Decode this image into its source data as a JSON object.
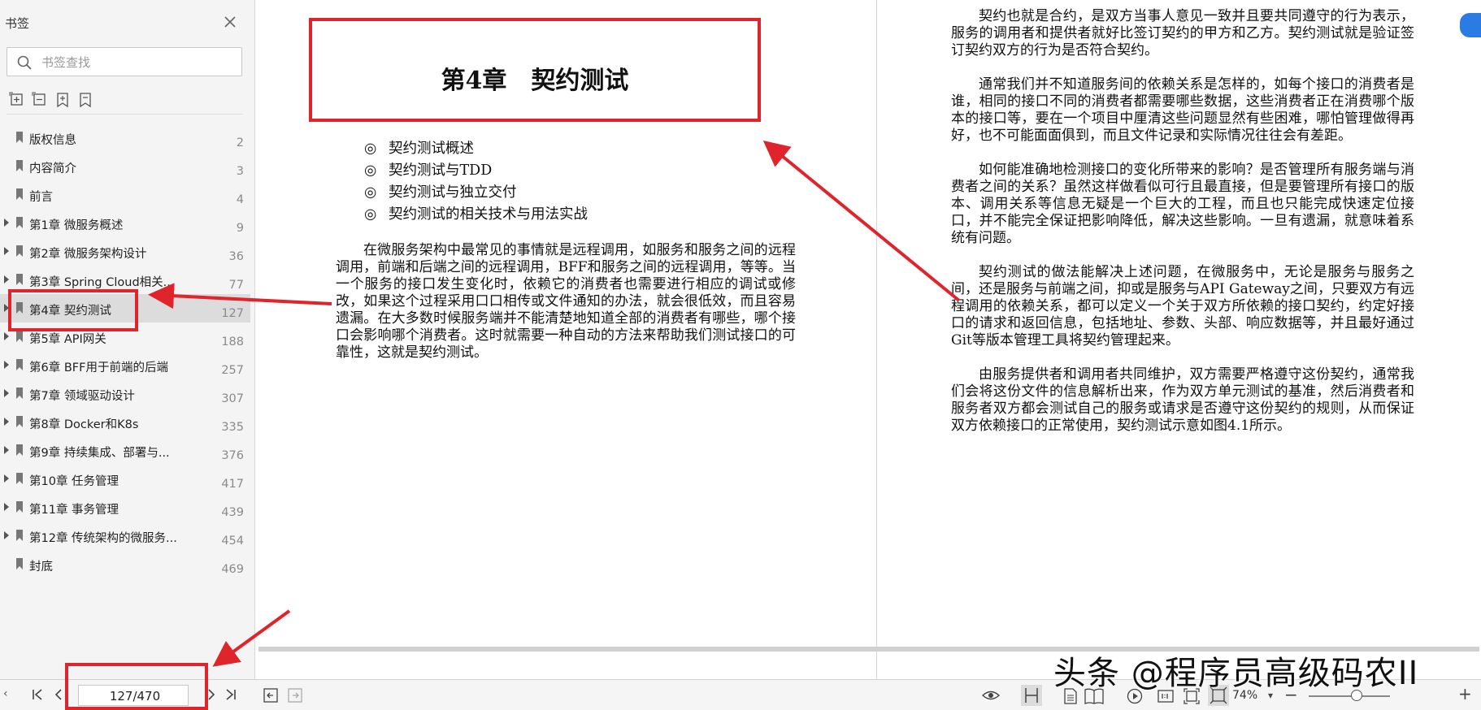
{
  "sidebar": {
    "title": "书签",
    "search_placeholder": "书签查找",
    "items": [
      {
        "label": "版权信息",
        "page": "2",
        "expandable": false
      },
      {
        "label": "内容简介",
        "page": "3",
        "expandable": false
      },
      {
        "label": "前言",
        "page": "4",
        "expandable": false
      },
      {
        "label": "第1章 微服务概述",
        "page": "9",
        "expandable": true
      },
      {
        "label": "第2章 微服务架构设计",
        "page": "36",
        "expandable": true
      },
      {
        "label": "第3章 Spring Cloud相关...",
        "page": "77",
        "expandable": true
      },
      {
        "label": "第4章 契约测试",
        "page": "127",
        "expandable": true,
        "selected": true
      },
      {
        "label": "第5章 API网关",
        "page": "188",
        "expandable": true
      },
      {
        "label": "第6章 BFF用于前端的后端",
        "page": "257",
        "expandable": true
      },
      {
        "label": "第7章 领域驱动设计",
        "page": "307",
        "expandable": true
      },
      {
        "label": "第8章 Docker和K8s",
        "page": "335",
        "expandable": true
      },
      {
        "label": "第9章 持续集成、部署与...",
        "page": "376",
        "expandable": true
      },
      {
        "label": "第10章 任务管理",
        "page": "417",
        "expandable": true
      },
      {
        "label": "第11章 事务管理",
        "page": "439",
        "expandable": true
      },
      {
        "label": "第12章 传统架构的微服务...",
        "page": "454",
        "expandable": true
      },
      {
        "label": "封底",
        "page": "469",
        "expandable": false
      }
    ]
  },
  "page_left": {
    "chapter_title": "第4章　契约测试",
    "toc": [
      "契约测试概述",
      "契约测试与TDD",
      "契约测试与独立交付",
      "契约测试的相关技术与用法实战"
    ],
    "toc_marker": "◎",
    "intro": "在微服务架构中最常见的事情就是远程调用，如服务和服务之间的远程调用，前端和后端之间的远程调用，BFF和服务之间的远程调用，等等。当一个服务的接口发生变化时，依赖它的消费者也需要进行相应的调试或修改，如果这个过程采用口口相传或文件通知的办法，就会很低效，而且容易遗漏。在大多数时候服务端并不能清楚地知道全部的消费者有哪些，哪个接口会影响哪个消费者。这时就需要一种自动的方法来帮助我们测试接口的可靠性，这就是契约测试。"
  },
  "page_right": {
    "paragraphs": [
      "契约也就是合约，是双方当事人意见一致并且要共同遵守的行为表示，服务的调用者和提供者就好比签订契约的甲方和乙方。契约测试就是验证签订契约双方的行为是否符合契约。",
      "通常我们并不知道服务间的依赖关系是怎样的，如每个接口的消费者是谁，相同的接口不同的消费者都需要哪些数据，这些消费者正在消费哪个版本的接口等，要在一个项目中厘清这些问题显然有些困难，哪怕管理做得再好，也不可能面面俱到，而且文件记录和实际情况往往会有差距。",
      "如何能准确地检测接口的变化所带来的影响？是否管理所有服务端与消费者之间的关系？虽然这样做看似可行且最直接，但是要管理所有接口的版本、调用关系等信息无疑是一个巨大的工程，而且也只能完成快速定位接口，并不能完全保证把影响降低，解决这些影响。一旦有遗漏，就意味着系统有问题。",
      "契约测试的做法能解决上述问题，在微服务中，无论是服务与服务之间，还是服务与前端之间，抑或是服务与API Gateway之间，只要双方有远程调用的依赖关系，都可以定义一个关于双方所依赖的接口契约，约定好接口的请求和返回信息，包括地址、参数、头部、响应数据等，并且最好通过Git等版本管理工具将契约管理起来。",
      "由服务提供者和调用者共同维护，双方需要严格遵守这份契约，通常我们会将这份文件的信息解析出来，作为双方单元测试的基准，然后消费者和服务者双方都会测试自己的服务或请求是否遵守这份契约的规则，从而保证双方依赖接口的正常使用，契约测试示意如图4.1所示。"
    ]
  },
  "bottombar": {
    "page_indicator": "127/470",
    "zoom": "74%",
    "zoom_fraction": 0.74
  },
  "watermark": "头条 @程序员高级码农II",
  "colors": {
    "annotation": "#e0242b",
    "sidebar_bg": "#f4f4f4",
    "selected_bg": "#dcdcdc"
  }
}
